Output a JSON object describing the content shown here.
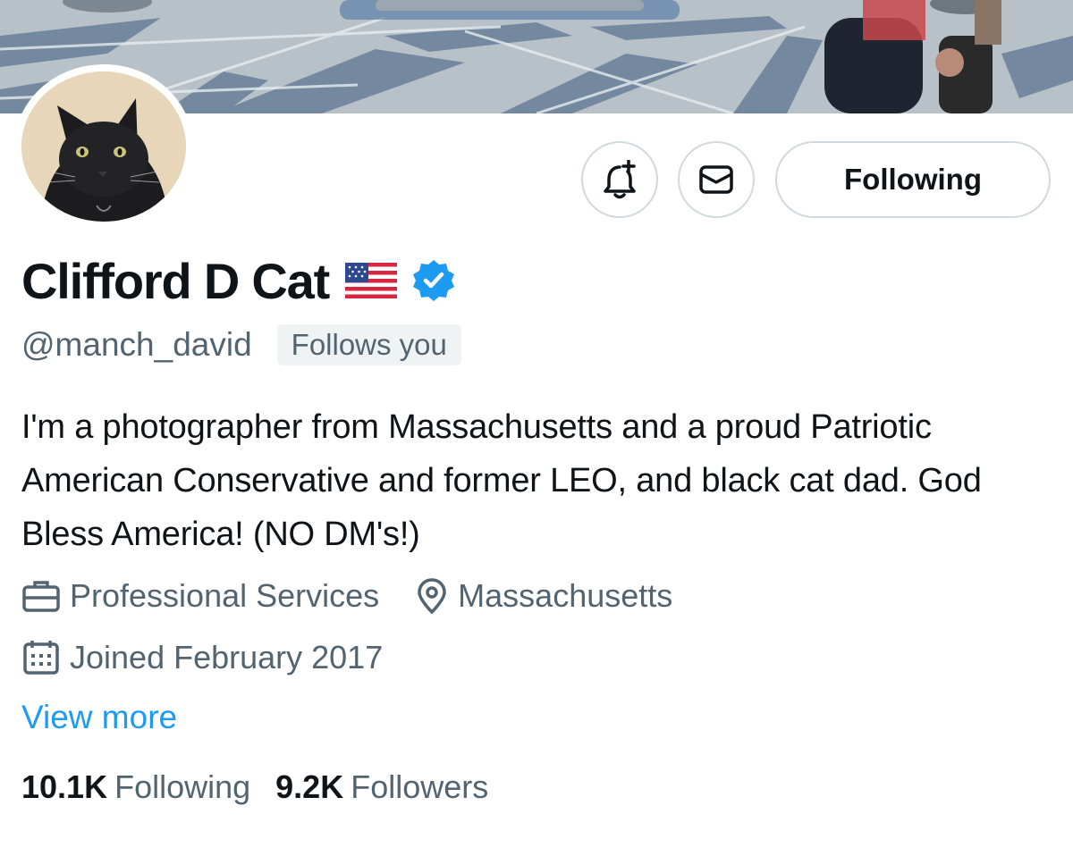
{
  "profile": {
    "display_name": "Clifford D Cat",
    "flag_emoji": "🇺🇸",
    "verified": true,
    "handle": "@manch_david",
    "follows_you_badge": "Follows you",
    "bio": "I'm a photographer from Massachusetts and a proud Patriotic American Conservative and former LEO, and black cat dad. God Bless America! (NO DM's!)",
    "category": "Professional Services",
    "location": "Massachusetts",
    "joined": "Joined February 2017",
    "view_more": "View more"
  },
  "actions": {
    "notifications_icon": "bell-plus-icon",
    "message_icon": "envelope-icon",
    "follow_button_label": "Following"
  },
  "stats": {
    "following_count": "10.1K",
    "following_label": "Following",
    "followers_count": "9.2K",
    "followers_label": "Followers"
  },
  "colors": {
    "accent": "#1d9bf0",
    "verified_badge": "#1d9bf0",
    "text_primary": "#0f1419",
    "text_secondary": "#536471",
    "border": "#cfd9de"
  }
}
